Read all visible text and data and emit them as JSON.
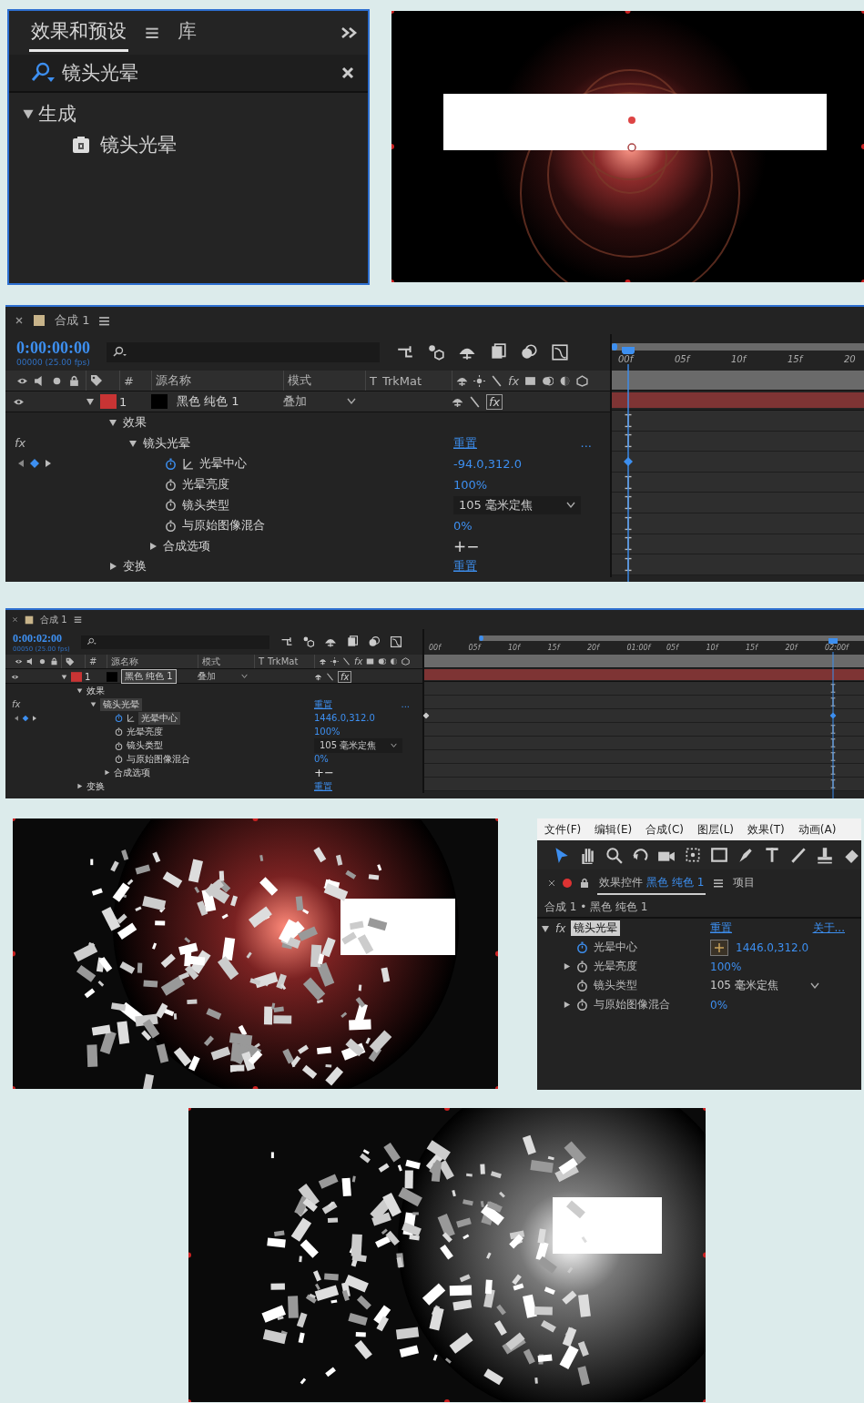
{
  "effects_panel": {
    "tabs": [
      {
        "label": "效果和预设",
        "selected": true
      },
      {
        "label": "库",
        "selected": false
      }
    ],
    "search": {
      "value": "镜头光晕"
    },
    "tree": [
      {
        "label": "生成",
        "expanded": true,
        "children": [
          {
            "label": "镜头光晕"
          }
        ]
      }
    ]
  },
  "timelines": [
    {
      "comp_tab": "合成 1",
      "timecode": "0:00:00:00",
      "frame_info": "00000 (25.00 fps)",
      "columns": [
        "#",
        "源名称",
        "模式",
        "T",
        "TrkMat"
      ],
      "header_fx": "fx",
      "ruler_ticks": [
        "00f",
        "05f",
        "10f",
        "15f",
        "20"
      ],
      "playhead": {
        "level": 0.025
      },
      "layer": {
        "number": "1",
        "name": "黑色 纯色 1",
        "selected": false,
        "color": "#c83434",
        "mode": "叠加",
        "fx": "fx",
        "effects_on": true,
        "expanded": true
      },
      "properties": [
        {
          "label": "效果",
          "expanded": true,
          "in_marker": true,
          "children": [
            {
              "label": "镜头光晕",
              "fx": "fx",
              "expanded": true,
              "selected": false,
              "value": "重置",
              "kind": "link",
              "extra": "...",
              "in_marker": true,
              "children": [
                {
                  "label": "光晕中心",
                  "animated": true,
                  "graph": true,
                  "selected": false,
                  "value": "-94.0,312.0",
                  "kind": "number",
                  "keyframe_at_start": false,
                  "keyframe_at_playhead": true
                },
                {
                  "label": "光晕亮度",
                  "animated": false,
                  "value": "100%",
                  "kind": "number",
                  "in_marker": true
                },
                {
                  "label": "镜头类型",
                  "animated": false,
                  "value": "105 毫米定焦",
                  "kind": "dropdown",
                  "in_marker": true
                },
                {
                  "label": "与原始图像混合",
                  "animated": false,
                  "value": "0%",
                  "kind": "number",
                  "in_marker": true
                },
                {
                  "label": "合成选项",
                  "expanded": false,
                  "value": "+−",
                  "kind": "plain",
                  "in_marker": true
                }
              ]
            }
          ]
        },
        {
          "label": "变换",
          "expanded": false,
          "value": "重置",
          "kind": "link",
          "in_marker": true
        }
      ]
    },
    {
      "comp_tab": "合成 1",
      "timecode": "0:00:02:00",
      "frame_info": "00050 (25.00 fps)",
      "columns": [
        "#",
        "源名称",
        "模式",
        "T",
        "TrkMat"
      ],
      "header_fx": "fx",
      "ruler_ticks": [
        "00f",
        "05f",
        "10f",
        "15f",
        "20f",
        "01:00f",
        "05f",
        "10f",
        "15f",
        "20f",
        "02:00f"
      ],
      "playhead": {
        "level": 0.93
      },
      "layer": {
        "number": "1",
        "name": "黑色 纯色 1",
        "selected": true,
        "color": "#c83434",
        "mode": "叠加",
        "fx": "fx",
        "effects_on": true,
        "expanded": true
      },
      "properties": [
        {
          "label": "效果",
          "expanded": true,
          "in_marker": true,
          "children": [
            {
              "label": "镜头光晕",
              "fx": "fx",
              "expanded": true,
              "selected": true,
              "value": "重置",
              "kind": "link",
              "extra": "...",
              "in_marker": true,
              "children": [
                {
                  "label": "光晕中心",
                  "animated": true,
                  "graph": true,
                  "selected": true,
                  "value": "1446.0,312.0",
                  "kind": "number",
                  "keyframe_at_start": true,
                  "keyframe_at_playhead": true
                },
                {
                  "label": "光晕亮度",
                  "animated": false,
                  "value": "100%",
                  "kind": "number",
                  "in_marker": true
                },
                {
                  "label": "镜头类型",
                  "animated": false,
                  "value": "105 毫米定焦",
                  "kind": "dropdown",
                  "in_marker": true
                },
                {
                  "label": "与原始图像混合",
                  "animated": false,
                  "value": "0%",
                  "kind": "number",
                  "in_marker": true
                },
                {
                  "label": "合成选项",
                  "expanded": false,
                  "value": "+−",
                  "kind": "plain",
                  "in_marker": true
                }
              ]
            }
          ]
        },
        {
          "label": "变换",
          "expanded": false,
          "value": "重置",
          "kind": "link",
          "in_marker": true
        }
      ]
    }
  ],
  "effect_controls": {
    "menu": [
      "文件(F)",
      "编辑(E)",
      "合成(C)",
      "图层(L)",
      "效果(T)",
      "动画(A)"
    ],
    "tabs": [
      {
        "label": "效果控件",
        "layer": "黑色 纯色 1",
        "selected": true
      },
      {
        "label": "项目",
        "selected": false
      }
    ],
    "breadcrumb": "合成 1 • 黑色 纯色 1",
    "effect": {
      "fx": "fx",
      "label": "镜头光晕",
      "selected": true,
      "expanded": true,
      "reset": "重置",
      "about": "关于..."
    },
    "properties": [
      {
        "label": "光晕中心",
        "animated": true,
        "value": "1446.0,312.0",
        "kind": "point"
      },
      {
        "label": "光晕亮度",
        "animated": false,
        "expanded": false,
        "value": "100%",
        "kind": "number"
      },
      {
        "label": "镜头类型",
        "animated": false,
        "value": "105 毫米定焦",
        "kind": "dropdown"
      },
      {
        "label": "与原始图像混合",
        "animated": false,
        "expanded": false,
        "value": "0%",
        "kind": "number"
      }
    ]
  }
}
